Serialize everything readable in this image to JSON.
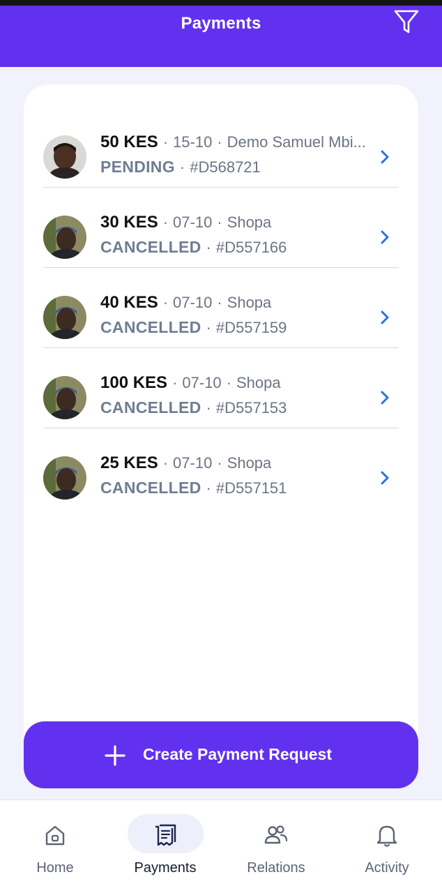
{
  "header": {
    "title": "Payments"
  },
  "payments": [
    {
      "amount": "50 KES",
      "date": "15-10",
      "party": "Demo Samuel Mbi...",
      "status": "PENDING",
      "ref": "#D568721",
      "avatar": "person-a"
    },
    {
      "amount": "30 KES",
      "date": "07-10",
      "party": "Shopa",
      "status": "CANCELLED",
      "ref": "#D557166",
      "avatar": "person-b"
    },
    {
      "amount": "40 KES",
      "date": "07-10",
      "party": "Shopa",
      "status": "CANCELLED",
      "ref": "#D557159",
      "avatar": "person-b"
    },
    {
      "amount": "100 KES",
      "date": "07-10",
      "party": "Shopa",
      "status": "CANCELLED",
      "ref": "#D557153",
      "avatar": "person-b"
    },
    {
      "amount": "25 KES",
      "date": "07-10",
      "party": "Shopa",
      "status": "CANCELLED",
      "ref": "#D557151",
      "avatar": "person-b"
    }
  ],
  "separator": "·",
  "cta": {
    "label": "Create Payment Request",
    "icon": "plus-icon"
  },
  "nav": [
    {
      "label": "Home",
      "icon": "home-icon",
      "active": false
    },
    {
      "label": "Payments",
      "icon": "receipt-icon",
      "active": true
    },
    {
      "label": "Relations",
      "icon": "people-icon",
      "active": false
    },
    {
      "label": "Activity",
      "icon": "bell-icon",
      "active": false
    }
  ],
  "colors": {
    "brand": "#6231ef",
    "chevron": "#2f6fe0",
    "status_text": "#6f7d94"
  }
}
